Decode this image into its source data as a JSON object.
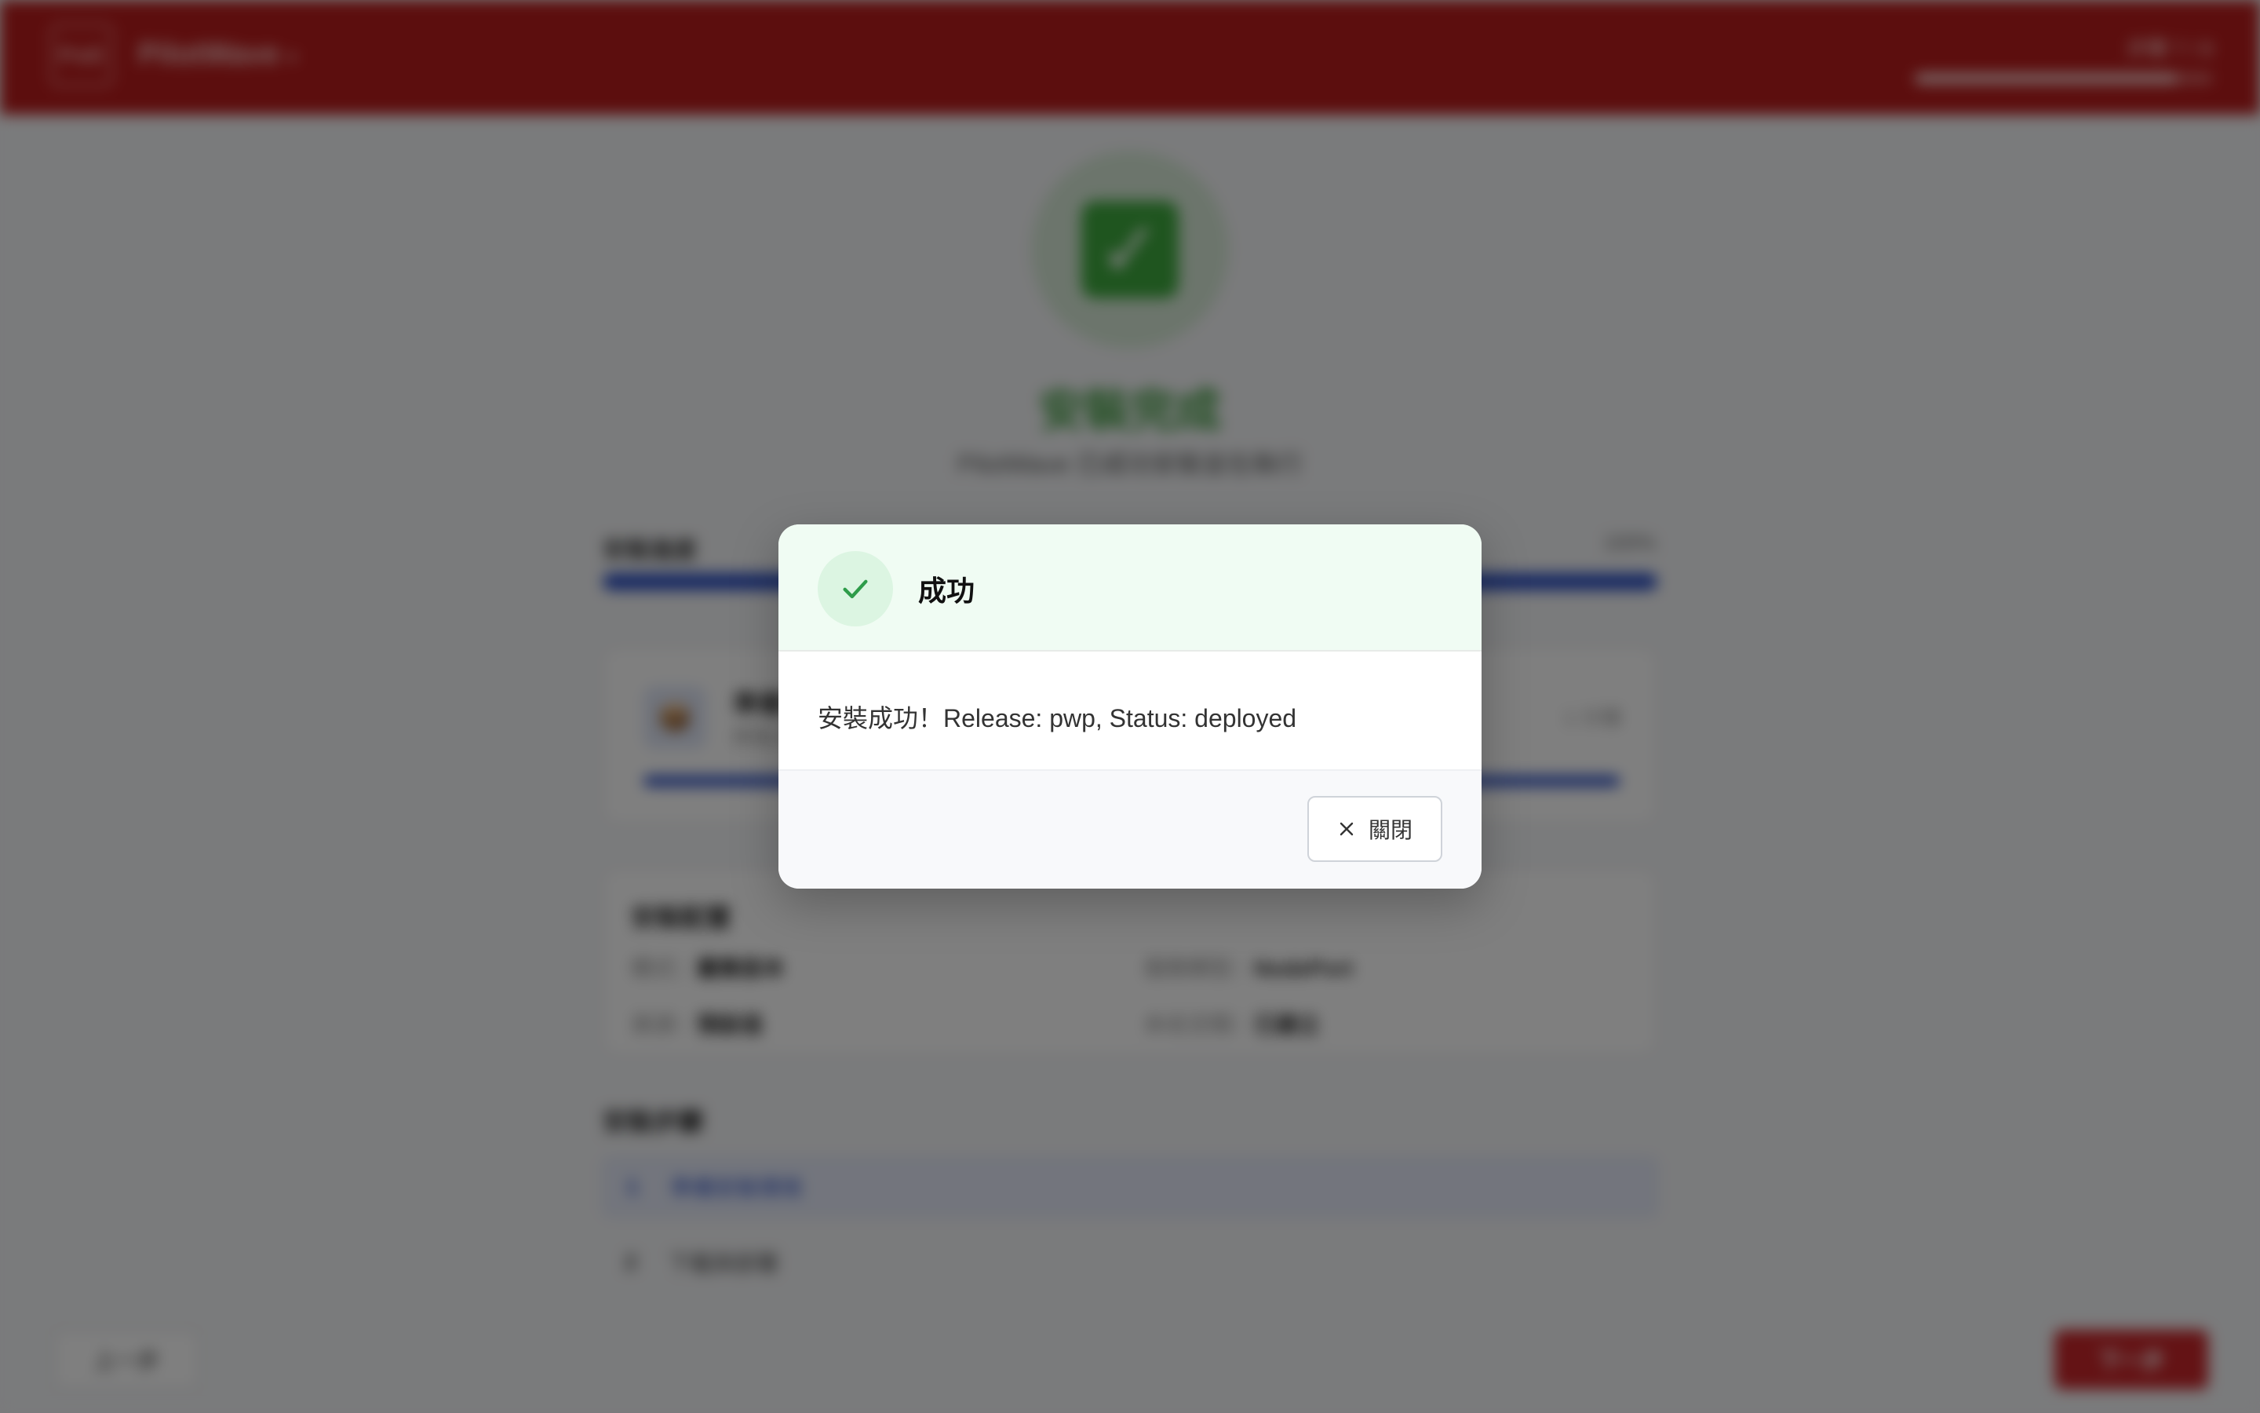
{
  "header": {
    "logo_text": "P∧E",
    "app_name": "PilotWave",
    "app_caret": "▾",
    "step_text": "步驟 7 / 8",
    "progress_fraction": 0.88
  },
  "main": {
    "success_glyph": "✓",
    "done_title": "安裝完成",
    "done_subtitle": "PilotWave 已成功安裝並在執行",
    "progress_label": "安裝進度",
    "progress_percent": "100%",
    "progress_fraction": 1.0,
    "task_card": {
      "icon": "📦",
      "title": "準備安裝環境",
      "subtitle": "所有元件已部署",
      "time": "1 分鐘",
      "progress_fraction": 1.0
    },
    "config_card": {
      "title": "安裝配置",
      "items": [
        {
          "label": "模式：",
          "value": "叢集版本"
        },
        {
          "label": "服務類型：",
          "value": "NodePort"
        },
        {
          "label": "資源：",
          "value": "預設值"
        },
        {
          "label": "命名空間：",
          "value": "已建立"
        }
      ]
    },
    "steps_title": "安裝步驟",
    "steps": [
      {
        "num": "1",
        "label": "準備安裝環境"
      },
      {
        "num": "2",
        "label": "下載與部署"
      }
    ]
  },
  "footer": {
    "prev_label": "上一步",
    "next_label": "下一步"
  },
  "dialog": {
    "title": "成功",
    "message": "安裝成功！Release: pwp, Status: deployed",
    "close_label": "關閉",
    "accent_color": "#2e9c4a",
    "header_bg": "#f0fcf3"
  }
}
